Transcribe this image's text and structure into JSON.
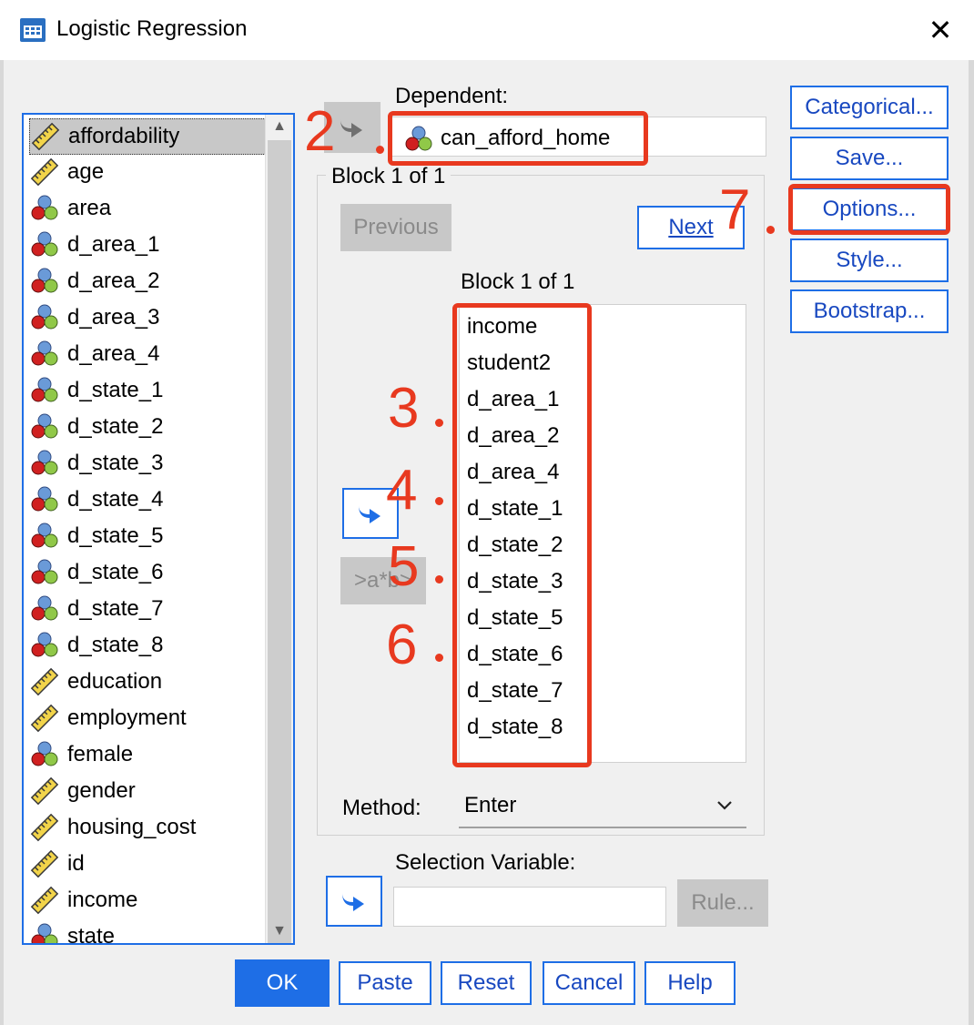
{
  "window": {
    "title": "Logistic Regression",
    "close_glyph": "✕"
  },
  "variables": [
    {
      "name": "affordability",
      "icon": "scale-icon"
    },
    {
      "name": "age",
      "icon": "scale-icon"
    },
    {
      "name": "area",
      "icon": "nominal-icon"
    },
    {
      "name": "d_area_1",
      "icon": "nominal-icon"
    },
    {
      "name": "d_area_2",
      "icon": "nominal-icon"
    },
    {
      "name": "d_area_3",
      "icon": "nominal-icon"
    },
    {
      "name": "d_area_4",
      "icon": "nominal-icon"
    },
    {
      "name": "d_state_1",
      "icon": "nominal-icon"
    },
    {
      "name": "d_state_2",
      "icon": "nominal-icon"
    },
    {
      "name": "d_state_3",
      "icon": "nominal-icon"
    },
    {
      "name": "d_state_4",
      "icon": "nominal-icon"
    },
    {
      "name": "d_state_5",
      "icon": "nominal-icon"
    },
    {
      "name": "d_state_6",
      "icon": "nominal-icon"
    },
    {
      "name": "d_state_7",
      "icon": "nominal-icon"
    },
    {
      "name": "d_state_8",
      "icon": "nominal-icon"
    },
    {
      "name": "education",
      "icon": "scale-icon"
    },
    {
      "name": "employment",
      "icon": "scale-icon"
    },
    {
      "name": "female",
      "icon": "nominal-icon"
    },
    {
      "name": "gender",
      "icon": "scale-icon"
    },
    {
      "name": "housing_cost",
      "icon": "scale-icon"
    },
    {
      "name": "id",
      "icon": "scale-icon"
    },
    {
      "name": "income",
      "icon": "scale-icon"
    },
    {
      "name": "state",
      "icon": "nominal-icon"
    }
  ],
  "dependent": {
    "label": "Dependent:",
    "value": "can_afford_home"
  },
  "block": {
    "group_title": "Block 1 of 1",
    "previous": "Previous",
    "next": "Next",
    "list_title": "Block 1 of 1",
    "interaction_button": ">a*b>",
    "covariates": [
      "income",
      "student2",
      "d_area_1",
      "d_area_2",
      "d_area_4",
      "d_state_1",
      "d_state_2",
      "d_state_3",
      "d_state_5",
      "d_state_6",
      "d_state_7",
      "d_state_8"
    ]
  },
  "method": {
    "label": "Method:",
    "value": "Enter"
  },
  "selection": {
    "label": "Selection Variable:",
    "value": "",
    "rule": "Rule..."
  },
  "side_buttons": [
    "Categorical...",
    "Save...",
    "Options...",
    "Style...",
    "Bootstrap..."
  ],
  "bottom_buttons": [
    "OK",
    "Paste",
    "Reset",
    "Cancel",
    "Help"
  ],
  "annotations": [
    "2",
    "3",
    "4",
    "5",
    "6",
    "7"
  ],
  "colors": {
    "accent": "#1e6ee6",
    "annotation": "#e8391f",
    "selected": "#c8c8c8"
  }
}
